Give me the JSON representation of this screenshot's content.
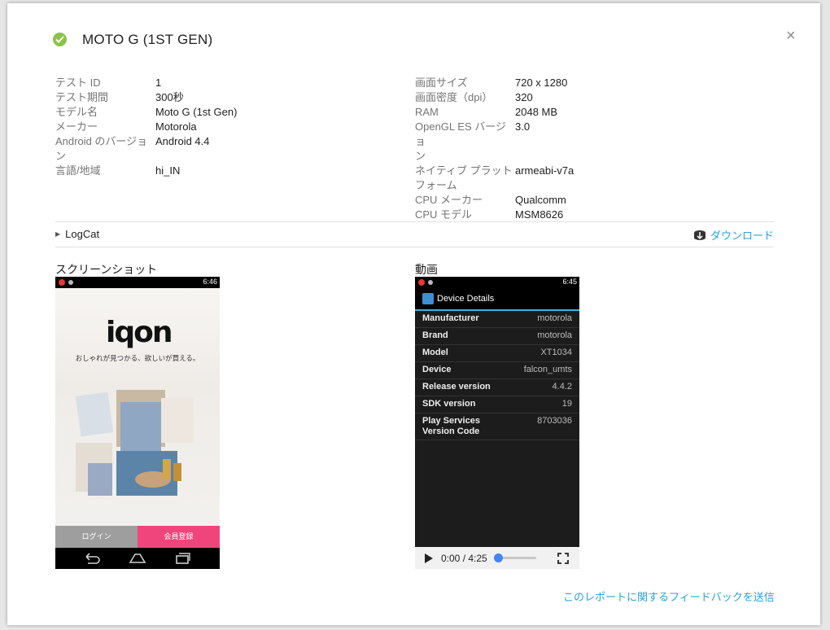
{
  "dialog": {
    "title": "MOTO G (1ST GEN)",
    "close_symbol": "×",
    "status_icon": "check-circle-icon",
    "status_color": "#8bc34a"
  },
  "info_left": [
    {
      "label": "テスト ID",
      "value": "1"
    },
    {
      "label": "テスト期間",
      "value": "300秒"
    },
    {
      "label": "モデル名",
      "value": "Moto G (1st Gen)"
    },
    {
      "label": "メーカー",
      "value": "Motorola"
    },
    {
      "label": "Android のバージョ\nン",
      "value": "Android 4.4"
    },
    {
      "label": "言語/地域",
      "value": "hi_IN"
    }
  ],
  "info_right": [
    {
      "label": "画面サイズ",
      "value": "720 x 1280"
    },
    {
      "label": "画面密度（dpi）",
      "value": "320"
    },
    {
      "label": "RAM",
      "value": "2048 MB"
    },
    {
      "label": "OpenGL ES バージョ\nン",
      "value": "3.0"
    },
    {
      "label": "ネイティブ プラット\nフォーム",
      "value": "armeabi-v7a"
    },
    {
      "label": "CPU メーカー",
      "value": "Qualcomm"
    },
    {
      "label": "CPU モデル",
      "value": "MSM8626"
    }
  ],
  "logcat": {
    "label": "LogCat",
    "download_label": "ダウンロード"
  },
  "screenshot": {
    "section_label": "スクリーンショット",
    "status_time": "6:46",
    "logo": "iqon",
    "tagline": "おしゃれが見つかる、欲しいが買える。",
    "login_label": "ログイン",
    "signup_label": "会員登録"
  },
  "video": {
    "section_label": "動画",
    "status_time": "6:45",
    "app_title": "Device Details",
    "rows": [
      {
        "key": "Manufacturer",
        "value": "motorola"
      },
      {
        "key": "Brand",
        "value": "motorola"
      },
      {
        "key": "Model",
        "value": "XT1034"
      },
      {
        "key": "Device",
        "value": "falcon_umts"
      },
      {
        "key": "Release version",
        "value": "4.4.2"
      },
      {
        "key": "SDK version",
        "value": "19"
      },
      {
        "key": "Play Services\nVersion Code",
        "value": "8703036"
      }
    ],
    "time_display": "0:00 / 4:25",
    "progress": 0
  },
  "feedback_link": "このレポートに関するフィードバックを送信",
  "colors": {
    "accent": "#29a3d6",
    "signup": "#f0457c",
    "holo_blue": "#33b5e5"
  }
}
